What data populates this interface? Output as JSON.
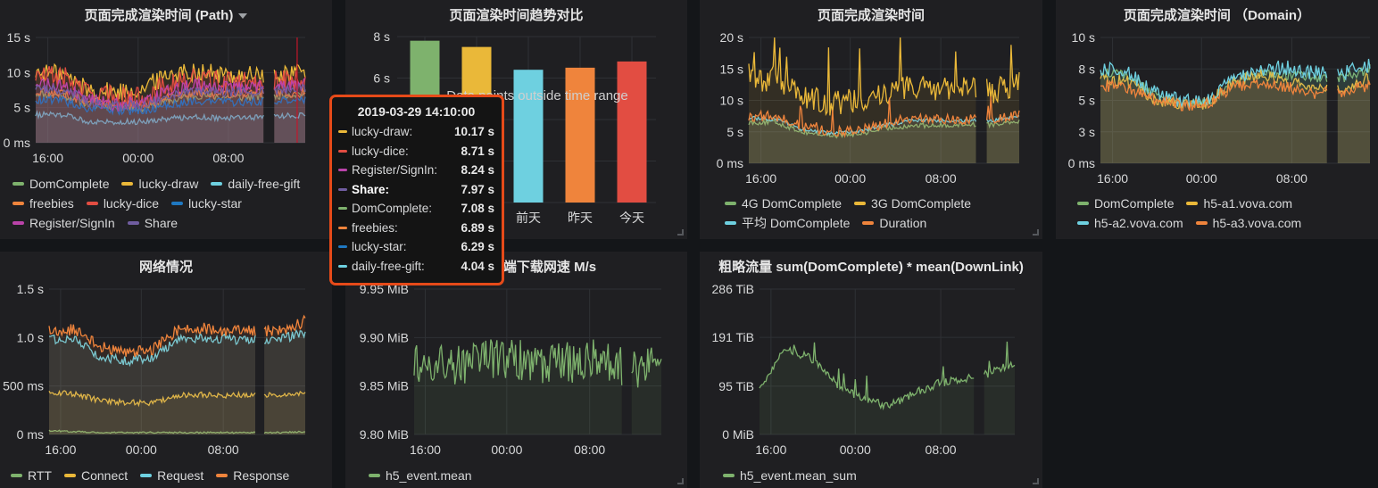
{
  "dashboard": {
    "background": "#141619",
    "panel_background": "#1f1f22"
  },
  "tooltip": {
    "time": "2019-03-29 14:10:00",
    "border_color": "#e64a19",
    "rows": [
      {
        "label": "lucky-draw:",
        "value": "10.17 s",
        "color": "#eab839",
        "bold": false
      },
      {
        "label": "lucky-dice:",
        "value": "8.71 s",
        "color": "#e24d42",
        "bold": false
      },
      {
        "label": "Register/SignIn:",
        "value": "8.24 s",
        "color": "#ba43a9",
        "bold": false
      },
      {
        "label": "Share:",
        "value": "7.97 s",
        "color": "#705da0",
        "bold": true
      },
      {
        "label": "DomComplete:",
        "value": "7.08 s",
        "color": "#7eb26d",
        "bold": false
      },
      {
        "label": "freebies:",
        "value": "6.89 s",
        "color": "#ef843c",
        "bold": false
      },
      {
        "label": "lucky-star:",
        "value": "6.29 s",
        "color": "#1f78c1",
        "bold": false
      },
      {
        "label": "daily-free-gift:",
        "value": "4.04 s",
        "color": "#6ed0e0",
        "bold": false
      }
    ]
  },
  "chart_data": [
    {
      "id": "path",
      "type": "area",
      "title": "页面完成渲染时间 (Path)",
      "has_menu_caret": true,
      "ylim": [
        0,
        15
      ],
      "yticks": [
        {
          "v": 0,
          "label": "0 ms"
        },
        {
          "v": 5,
          "label": "5 s"
        },
        {
          "v": 10,
          "label": "10 s"
        },
        {
          "v": 15,
          "label": "15 s"
        }
      ],
      "xticks": [
        {
          "t": 0.045,
          "label": "16:00"
        },
        {
          "t": 0.38,
          "label": "00:00"
        },
        {
          "t": 0.715,
          "label": "08:00"
        }
      ],
      "gap": [
        0.85,
        0.88
      ],
      "grid": true,
      "legend_position": "bottom",
      "annotation_line_t": 0.97,
      "series": [
        {
          "name": "DomComplete",
          "color": "#7eb26d",
          "points": [
            7.0,
            6.8,
            5.5,
            5.2,
            5.0,
            6.0,
            6.8,
            6.5,
            6.5,
            6.8,
            7.0
          ],
          "noise": 0.6
        },
        {
          "name": "lucky-draw",
          "color": "#eab839",
          "points": [
            10.0,
            9.8,
            7.5,
            7.2,
            7.8,
            10.0,
            10.2,
            9.6,
            9.6,
            9.8,
            10.2
          ],
          "noise": 1.4
        },
        {
          "name": "daily-free-gift",
          "color": "#6ed0e0",
          "points": [
            4.0,
            4.0,
            3.0,
            3.0,
            3.0,
            3.5,
            3.7,
            3.5,
            3.6,
            3.8,
            4.0
          ],
          "noise": 0.4
        },
        {
          "name": "freebies",
          "color": "#ef843c",
          "points": [
            7.2,
            7.0,
            5.8,
            5.5,
            5.2,
            6.5,
            7.2,
            7.0,
            7.0,
            7.0,
            7.2
          ],
          "noise": 0.7
        },
        {
          "name": "lucky-dice",
          "color": "#e24d42",
          "points": [
            9.5,
            9.5,
            7.0,
            6.5,
            6.5,
            8.5,
            9.0,
            8.5,
            8.5,
            8.8,
            9.0
          ],
          "noise": 1.6
        },
        {
          "name": "lucky-star",
          "color": "#1f78c1",
          "points": [
            6.2,
            6.0,
            4.8,
            4.6,
            4.5,
            5.5,
            6.0,
            5.8,
            5.8,
            6.0,
            6.2
          ],
          "noise": 0.6
        },
        {
          "name": "Register/SignIn",
          "color": "#ba43a9",
          "points": [
            8.5,
            8.0,
            6.0,
            5.5,
            5.5,
            7.5,
            8.2,
            7.8,
            7.8,
            8.0,
            8.2
          ],
          "noise": 1.0
        },
        {
          "name": "Share",
          "color": "#705da0",
          "points": [
            7.8,
            7.6,
            5.8,
            5.4,
            5.3,
            6.8,
            7.6,
            7.2,
            7.2,
            7.5,
            7.8
          ],
          "noise": 0.7
        }
      ]
    },
    {
      "id": "trend",
      "type": "bar",
      "title": "页面渲染时间趋势对比",
      "ylim": [
        0,
        8
      ],
      "yticks": [
        {
          "v": 6,
          "label": "6 s"
        },
        {
          "v": 8,
          "label": "8 s"
        }
      ],
      "grid_values": [
        0,
        2,
        4,
        6,
        8
      ],
      "overlay_message": "Data points outside time range",
      "categories": [
        "",
        "",
        "前天",
        "昨天",
        "今天"
      ],
      "values": [
        7.8,
        7.5,
        6.4,
        6.5,
        6.8
      ],
      "colors": [
        "#7eb26d",
        "#eab839",
        "#6ed0e0",
        "#ef843c",
        "#e24d42"
      ]
    },
    {
      "id": "dom",
      "type": "area",
      "title": "页面完成渲染时间",
      "ylim": [
        0,
        20
      ],
      "yticks": [
        {
          "v": 0,
          "label": "0 ms"
        },
        {
          "v": 5,
          "label": "5 s"
        },
        {
          "v": 10,
          "label": "10 s"
        },
        {
          "v": 15,
          "label": "15 s"
        },
        {
          "v": 20,
          "label": "20 s"
        }
      ],
      "xticks": [
        {
          "t": 0.045,
          "label": "16:00"
        },
        {
          "t": 0.375,
          "label": "00:00"
        },
        {
          "t": 0.71,
          "label": "08:00"
        }
      ],
      "gap": [
        0.845,
        0.875
      ],
      "grid": true,
      "legend_position": "bottom",
      "series": [
        {
          "name": "4G DomComplete",
          "color": "#7eb26d",
          "points": [
            6.5,
            6.5,
            5.0,
            4.4,
            4.6,
            5.5,
            6.0,
            6.0,
            6.2,
            6.2,
            6.8
          ],
          "noise": 0.4
        },
        {
          "name": "3G DomComplete",
          "color": "#eab839",
          "points": [
            13.0,
            13.5,
            10.5,
            9.5,
            10.0,
            11.0,
            12.0,
            12.0,
            12.0,
            11.5,
            12.5
          ],
          "noise": 2.0,
          "spikes": 0.06
        },
        {
          "name": "平均 DomComplete",
          "color": "#6ed0e0",
          "points": [
            7.2,
            7.0,
            5.4,
            4.8,
            5.0,
            6.0,
            6.8,
            6.8,
            6.8,
            6.8,
            7.3
          ],
          "noise": 0.3
        },
        {
          "name": "Duration",
          "color": "#ef843c",
          "points": [
            7.5,
            7.5,
            5.8,
            5.0,
            5.2,
            6.3,
            7.0,
            7.0,
            7.0,
            7.0,
            7.8
          ],
          "noise": 0.8,
          "spikes": 0.05
        }
      ]
    },
    {
      "id": "domain",
      "type": "area",
      "title": "页面完成渲染时间 （Domain）",
      "ylim": [
        0,
        10
      ],
      "yticks": [
        {
          "v": 0,
          "label": "0 ms"
        },
        {
          "v": 2.5,
          "label": "3 s"
        },
        {
          "v": 5,
          "label": "5 s"
        },
        {
          "v": 7.5,
          "label": "8 s"
        },
        {
          "v": 10,
          "label": "10 s"
        }
      ],
      "xticks": [
        {
          "t": 0.045,
          "label": "16:00"
        },
        {
          "t": 0.375,
          "label": "00:00"
        },
        {
          "t": 0.71,
          "label": "08:00"
        }
      ],
      "gap": [
        0.845,
        0.875
      ],
      "grid": true,
      "legend_position": "bottom",
      "series": [
        {
          "name": "DomComplete",
          "color": "#7eb26d",
          "points": [
            7.2,
            7.0,
            5.5,
            4.8,
            4.8,
            6.5,
            7.2,
            7.0,
            6.8,
            6.8,
            7.5
          ],
          "noise": 0.4
        },
        {
          "name": "h5-a1.vova.com",
          "color": "#eab839",
          "points": [
            6.8,
            6.5,
            5.0,
            4.6,
            4.8,
            6.6,
            7.0,
            6.5,
            6.2,
            6.0,
            6.8
          ],
          "noise": 0.5
        },
        {
          "name": "h5-a2.vova.com",
          "color": "#6ed0e0",
          "points": [
            7.5,
            7.3,
            5.6,
            4.9,
            5.0,
            6.8,
            7.5,
            7.6,
            7.2,
            7.2,
            7.8
          ],
          "noise": 0.6
        },
        {
          "name": "h5-a3.vova.com",
          "color": "#ef843c",
          "points": [
            6.2,
            6.0,
            5.0,
            4.6,
            4.8,
            6.2,
            6.3,
            6.0,
            5.6,
            5.6,
            6.3
          ],
          "noise": 0.5
        }
      ]
    },
    {
      "id": "network",
      "type": "area",
      "title": "网络情况",
      "ylim": [
        0,
        1.5
      ],
      "yticks": [
        {
          "v": 0,
          "label": "0 ms"
        },
        {
          "v": 0.5,
          "label": "500 ms"
        },
        {
          "v": 1.0,
          "label": "1.0 s"
        },
        {
          "v": 1.5,
          "label": "1.5 s"
        }
      ],
      "xticks": [
        {
          "t": 0.045,
          "label": "16:00"
        },
        {
          "t": 0.36,
          "label": "00:00"
        },
        {
          "t": 0.68,
          "label": "08:00"
        }
      ],
      "gap": [
        0.81,
        0.835
      ],
      "grid": true,
      "legend_position": "bottom",
      "series": [
        {
          "name": "RTT",
          "color": "#7eb26d",
          "points": [
            0.04,
            0.03,
            0.02,
            0.02,
            0.02,
            0.02,
            0.02,
            0.02,
            0.02,
            0.02,
            0.03
          ],
          "noise": 0.008
        },
        {
          "name": "Connect",
          "color": "#eab839",
          "points": [
            0.43,
            0.42,
            0.35,
            0.33,
            0.33,
            0.4,
            0.41,
            0.4,
            0.41,
            0.41,
            0.44
          ],
          "noise": 0.03
        },
        {
          "name": "Request",
          "color": "#6ed0e0",
          "points": [
            0.98,
            1.0,
            0.8,
            0.76,
            0.78,
            0.98,
            1.0,
            0.98,
            0.98,
            0.98,
            1.05
          ],
          "noise": 0.05
        },
        {
          "name": "Response",
          "color": "#ef843c",
          "points": [
            1.08,
            1.08,
            0.9,
            0.85,
            0.86,
            1.08,
            1.1,
            1.06,
            1.07,
            1.07,
            1.17
          ],
          "noise": 0.06
        }
      ]
    },
    {
      "id": "speed",
      "type": "area",
      "title": "户端下载网速 M/s",
      "ylim": [
        9.8,
        9.95
      ],
      "yticks": [
        {
          "v": 9.8,
          "label": "9.80 MiB"
        },
        {
          "v": 9.85,
          "label": "9.85 MiB"
        },
        {
          "v": 9.9,
          "label": "9.90 MiB"
        },
        {
          "v": 9.95,
          "label": "9.95 MiB"
        }
      ],
      "xticks": [
        {
          "t": 0.045,
          "label": "16:00"
        },
        {
          "t": 0.375,
          "label": "00:00"
        },
        {
          "t": 0.71,
          "label": "08:00"
        }
      ],
      "gap": [
        0.845,
        0.875
      ],
      "grid": true,
      "legend_position": "bottom",
      "series": [
        {
          "name": "h5_event.mean",
          "color": "#7eb26d",
          "points": [
            9.875,
            9.872,
            9.874,
            9.878,
            9.878,
            9.872,
            9.874,
            9.876,
            9.876,
            9.868,
            9.874
          ],
          "noise": 0.022
        }
      ]
    },
    {
      "id": "traffic",
      "type": "area",
      "title": "粗略流量 sum(DomComplete) * mean(DownLink)",
      "ylim": [
        0,
        286
      ],
      "yticks": [
        {
          "v": 0,
          "label": "0 MiB"
        },
        {
          "v": 95,
          "label": "95 TiB"
        },
        {
          "v": 191,
          "label": "191 TiB"
        },
        {
          "v": 286,
          "label": "286 TiB"
        }
      ],
      "xticks": [
        {
          "t": 0.045,
          "label": "16:00"
        },
        {
          "t": 0.375,
          "label": "00:00"
        },
        {
          "t": 0.71,
          "label": "08:00"
        }
      ],
      "gap": [
        0.845,
        0.875
      ],
      "grid": true,
      "legend_position": "bottom",
      "series": [
        {
          "name": "h5_event.mean_sum",
          "color": "#7eb26d",
          "points": [
            90,
            170,
            150,
            100,
            70,
            55,
            80,
            100,
            110,
            120,
            140
          ],
          "noise": 8,
          "spikes": 0.04
        }
      ]
    }
  ]
}
